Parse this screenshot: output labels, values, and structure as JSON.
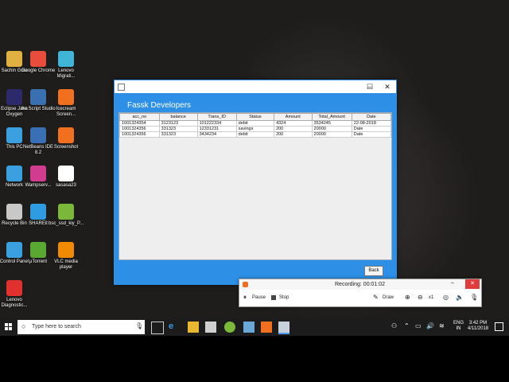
{
  "desktop_icons": [
    {
      "label": "Sachin Gola",
      "icon": "user-folder-icon",
      "color": "#e0b040"
    },
    {
      "label": "Google Chrome",
      "icon": "chrome-icon",
      "color": "#e74c3c"
    },
    {
      "label": "Lenovo Migrati...",
      "icon": "lenovo-migration-icon",
      "color": "#3fb6d8"
    },
    {
      "label": "Eclipse Java Oxygen",
      "icon": "eclipse-icon",
      "color": "#2c2a6b"
    },
    {
      "label": "lite Script Studio",
      "icon": "script-studio-icon",
      "color": "#3a6fb0"
    },
    {
      "label": "Icecream Screen...",
      "icon": "icecream-icon",
      "color": "#f07020"
    },
    {
      "label": "This PC",
      "icon": "computer-icon",
      "color": "#3aa0e0"
    },
    {
      "label": "NetBeans IDE 8.2",
      "icon": "netbeans-icon",
      "color": "#3b6fb5"
    },
    {
      "label": "Screenshot",
      "icon": "screenshot-icon",
      "color": "#f07020"
    },
    {
      "label": "Network",
      "icon": "network-icon",
      "color": "#3aa0e0"
    },
    {
      "label": "Wampserv...",
      "icon": "wamp-icon",
      "color": "#d23c8e"
    },
    {
      "label": "sasasa23",
      "icon": "file-icon",
      "color": "#ffffff"
    },
    {
      "label": "Recycle Bin",
      "icon": "recycle-bin-icon",
      "color": "#c8c8c8"
    },
    {
      "label": "SHAREit",
      "icon": "shareit-icon",
      "color": "#2f9be0"
    },
    {
      "label": "bsc_ssd_kiy_P...",
      "icon": "webm-video-icon",
      "color": "#7ab83a"
    },
    {
      "label": "Control Panel",
      "icon": "control-panel-icon",
      "color": "#3aa0e0"
    },
    {
      "label": "µTorrent",
      "icon": "utorrent-icon",
      "color": "#5aa832"
    },
    {
      "label": "VLC media player",
      "icon": "vlc-icon",
      "color": "#f08a00"
    },
    {
      "label": "Lenovo Diagnostic...",
      "icon": "lenovo-diagnostics-icon",
      "color": "#e0312f"
    }
  ],
  "window": {
    "heading": "Fassk Developers",
    "minimize": "–",
    "maximize": "☐",
    "close": "✕",
    "table": {
      "columns": [
        "acc_no",
        "balance",
        "Trans_ID",
        "Status",
        "Amount",
        "Total_Amount",
        "Date"
      ],
      "rows": [
        [
          "1001324354",
          "3123123",
          "101222334",
          "debit",
          "4324",
          "3534245",
          "22-08-2018"
        ],
        [
          "1001324356",
          "331323",
          "12331231",
          "savings",
          "200",
          "20000",
          "Date"
        ],
        [
          "1001324356",
          "331323",
          "3434234",
          "debit",
          "200",
          "20000",
          "Date"
        ]
      ]
    },
    "back_button": "Back"
  },
  "recorder": {
    "status": "Recording:  00:01:02",
    "pause": "Pause",
    "stop": "Stop",
    "draw": "Draw",
    "zoom": "x1"
  },
  "taskbar": {
    "search_placeholder": "Type here to search",
    "lang": "ENG",
    "region": "IN",
    "time": "3:42 PM",
    "date": "4/11/2018"
  }
}
